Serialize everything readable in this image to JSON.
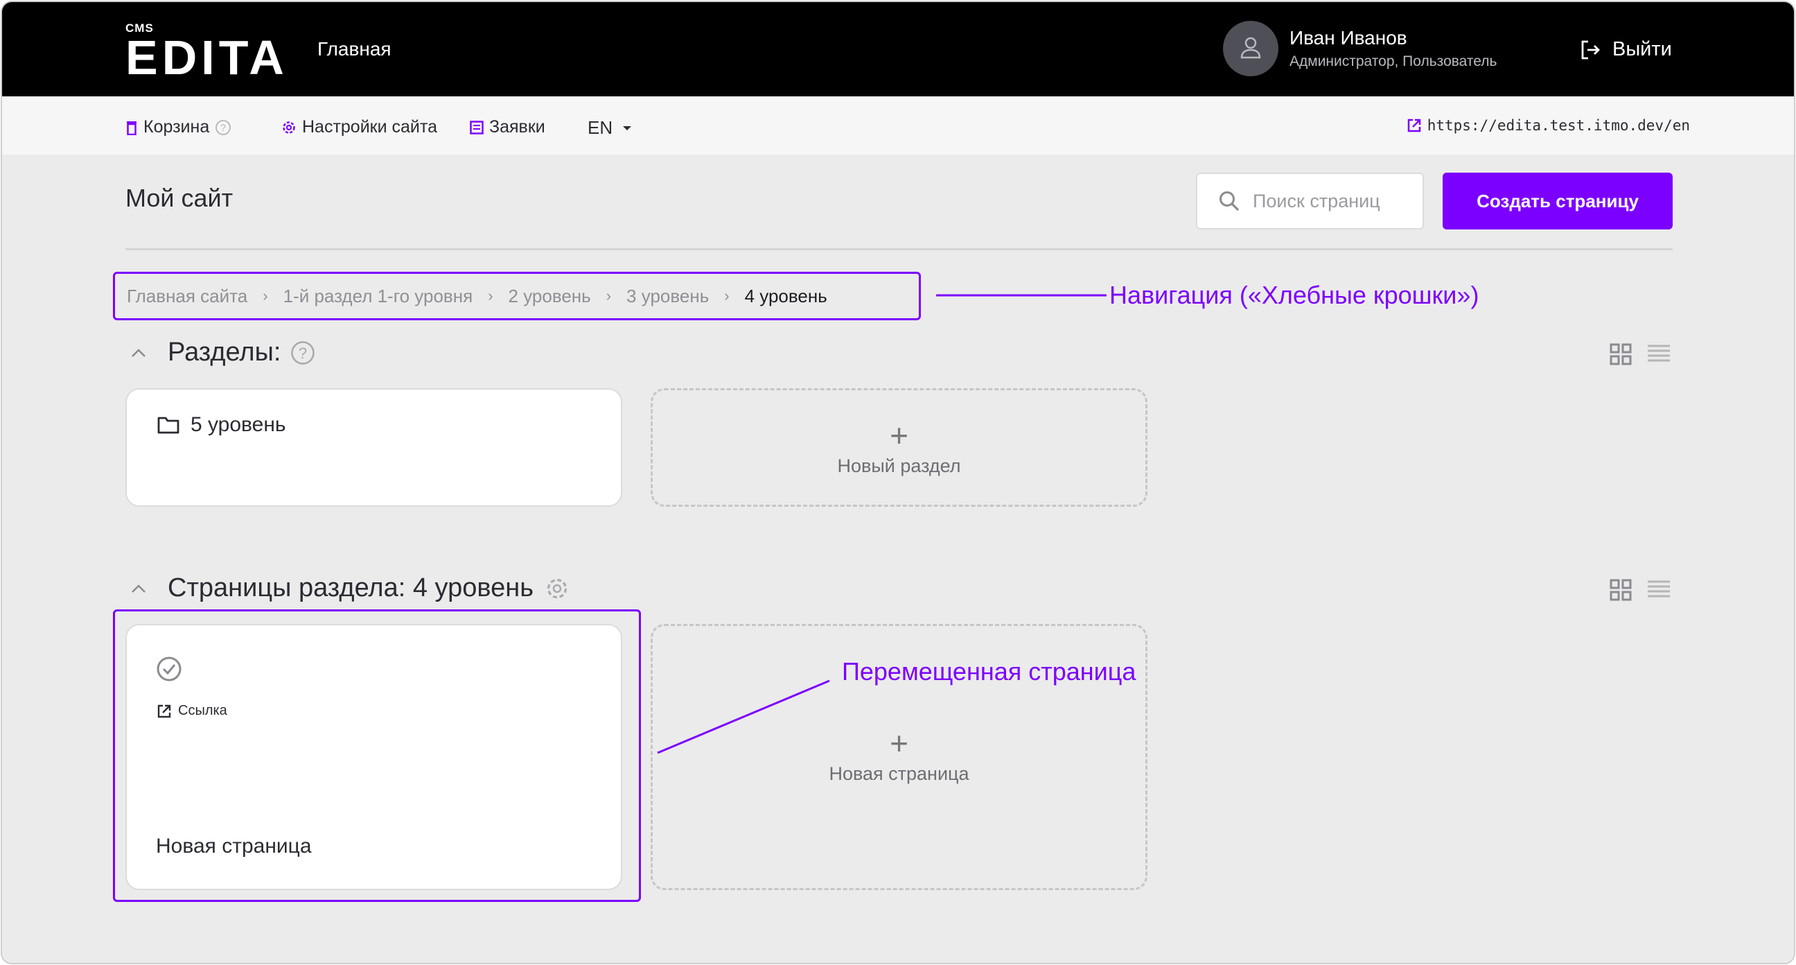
{
  "header": {
    "logo_cms": "CMS",
    "logo_main": "EDITA",
    "home_label": "Главная",
    "user_name": "Иван Иванов",
    "user_role": "Администратор, Пользователь",
    "logout_label": "Выйти"
  },
  "toolbar": {
    "trash_label": "Корзина",
    "settings_label": "Настройки сайта",
    "requests_label": "Заявки",
    "lang": "EN",
    "site_url": "https://edita.test.itmo.dev/en"
  },
  "page": {
    "title": "Мой сайт",
    "search_placeholder": "Поиск страниц",
    "create_button": "Создать страницу"
  },
  "breadcrumb": {
    "items": [
      "Главная сайта",
      "1-й раздел 1-го уровня",
      "2 уровень",
      "3 уровень",
      "4 уровень"
    ]
  },
  "sections": {
    "title": "Разделы:",
    "items": [
      {
        "label": "5 уровень"
      }
    ],
    "new_label": "Новый раздел"
  },
  "pages": {
    "title": "Страницы раздела: 4 уровень",
    "items": [
      {
        "link_label": "Ссылка",
        "title": "Новая страница"
      }
    ],
    "new_label": "Новая страница"
  },
  "annotations": {
    "breadcrumb_note": "Навигация («Хлебные крошки»)",
    "moved_note": "Перемещенная страница"
  },
  "colors": {
    "accent": "#7c00ff",
    "header_bg": "#000000",
    "page_bg": "#ebebeb"
  }
}
